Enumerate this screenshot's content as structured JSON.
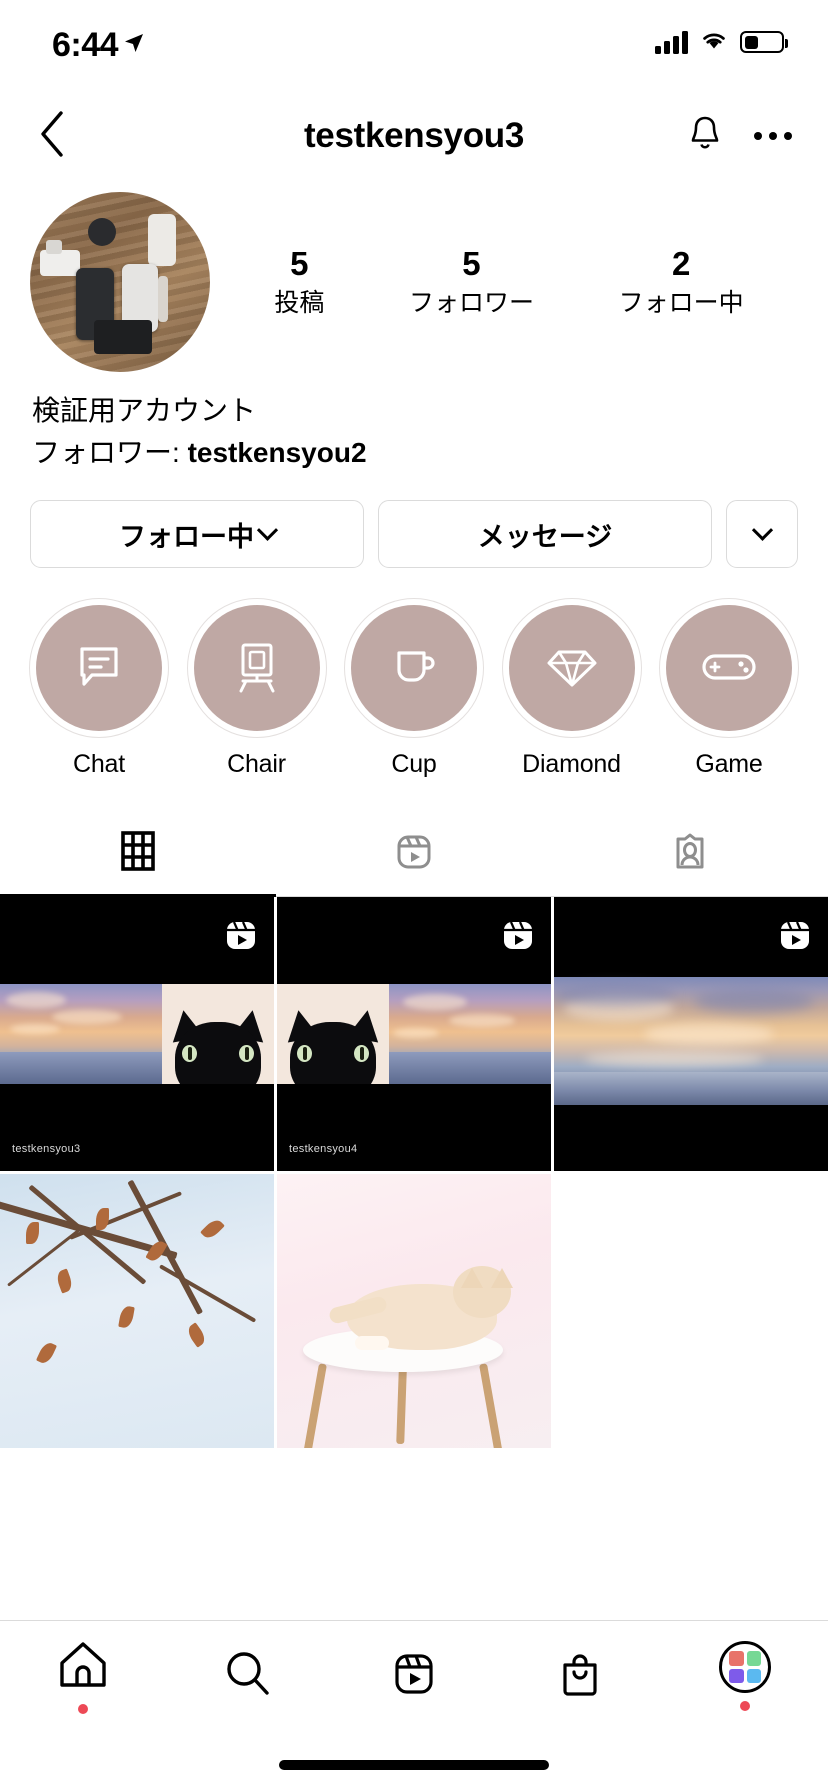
{
  "status_bar": {
    "time": "6:44",
    "location_icon": "location-arrow-icon",
    "signal_icon": "cellular-signal-icon",
    "wifi_icon": "wifi-icon",
    "battery_icon": "battery-icon"
  },
  "header": {
    "back_icon": "chevron-left-icon",
    "title": "testkensyou3",
    "bell_icon": "notification-bell-icon",
    "more_icon": "more-options-icon"
  },
  "profile": {
    "avatar_alt": "profile-photo",
    "stats": [
      {
        "value": "5",
        "label": "投稿"
      },
      {
        "value": "5",
        "label": "フォロワー"
      },
      {
        "value": "2",
        "label": "フォロー中"
      }
    ],
    "bio_name": "検証用アカウント",
    "followed_by_prefix": "フォロワー: ",
    "followed_by_user": "testkensyou2"
  },
  "actions": {
    "follow_label": "フォロー中",
    "message_label": "メッセージ",
    "more_icon": "chevron-down-icon"
  },
  "highlights": [
    {
      "label": "Chat",
      "icon": "chat-bubble-icon"
    },
    {
      "label": "Chair",
      "icon": "chair-icon"
    },
    {
      "label": "Cup",
      "icon": "cup-icon"
    },
    {
      "label": "Diamond",
      "icon": "diamond-icon"
    },
    {
      "label": "Game",
      "icon": "gamepad-icon"
    }
  ],
  "tabs": [
    {
      "name": "grid",
      "icon": "grid-icon",
      "active": true
    },
    {
      "name": "reels",
      "icon": "reels-icon",
      "active": false
    },
    {
      "name": "tagged",
      "icon": "tagged-icon",
      "active": false
    }
  ],
  "posts": [
    {
      "type": "reel",
      "icon": "reels-badge-icon",
      "watermark": "testkensyou3",
      "content": "sky-and-cat-collage"
    },
    {
      "type": "reel",
      "icon": "reels-badge-icon",
      "watermark": "testkensyou4",
      "content": "cat-and-sky-collage"
    },
    {
      "type": "reel",
      "icon": "reels-badge-icon",
      "watermark": "",
      "content": "sunset-sea-photo"
    },
    {
      "type": "photo",
      "icon": "",
      "watermark": "",
      "content": "winter-branches-photo"
    },
    {
      "type": "photo",
      "icon": "",
      "watermark": "",
      "content": "cat-on-stool-photo"
    }
  ],
  "bottom_nav": [
    {
      "name": "home",
      "icon": "home-icon",
      "badge": true
    },
    {
      "name": "search",
      "icon": "search-icon",
      "badge": false
    },
    {
      "name": "reels",
      "icon": "reels-icon",
      "badge": false
    },
    {
      "name": "shop",
      "icon": "shopping-bag-icon",
      "badge": false
    },
    {
      "name": "profile",
      "icon": "profile-avatar-icon",
      "badge": true
    }
  ],
  "colors": {
    "highlight_fill": "#bfa8a4",
    "border": "#dbdbdb",
    "badge_red": "#ed4956",
    "accent_black": "#000000"
  }
}
